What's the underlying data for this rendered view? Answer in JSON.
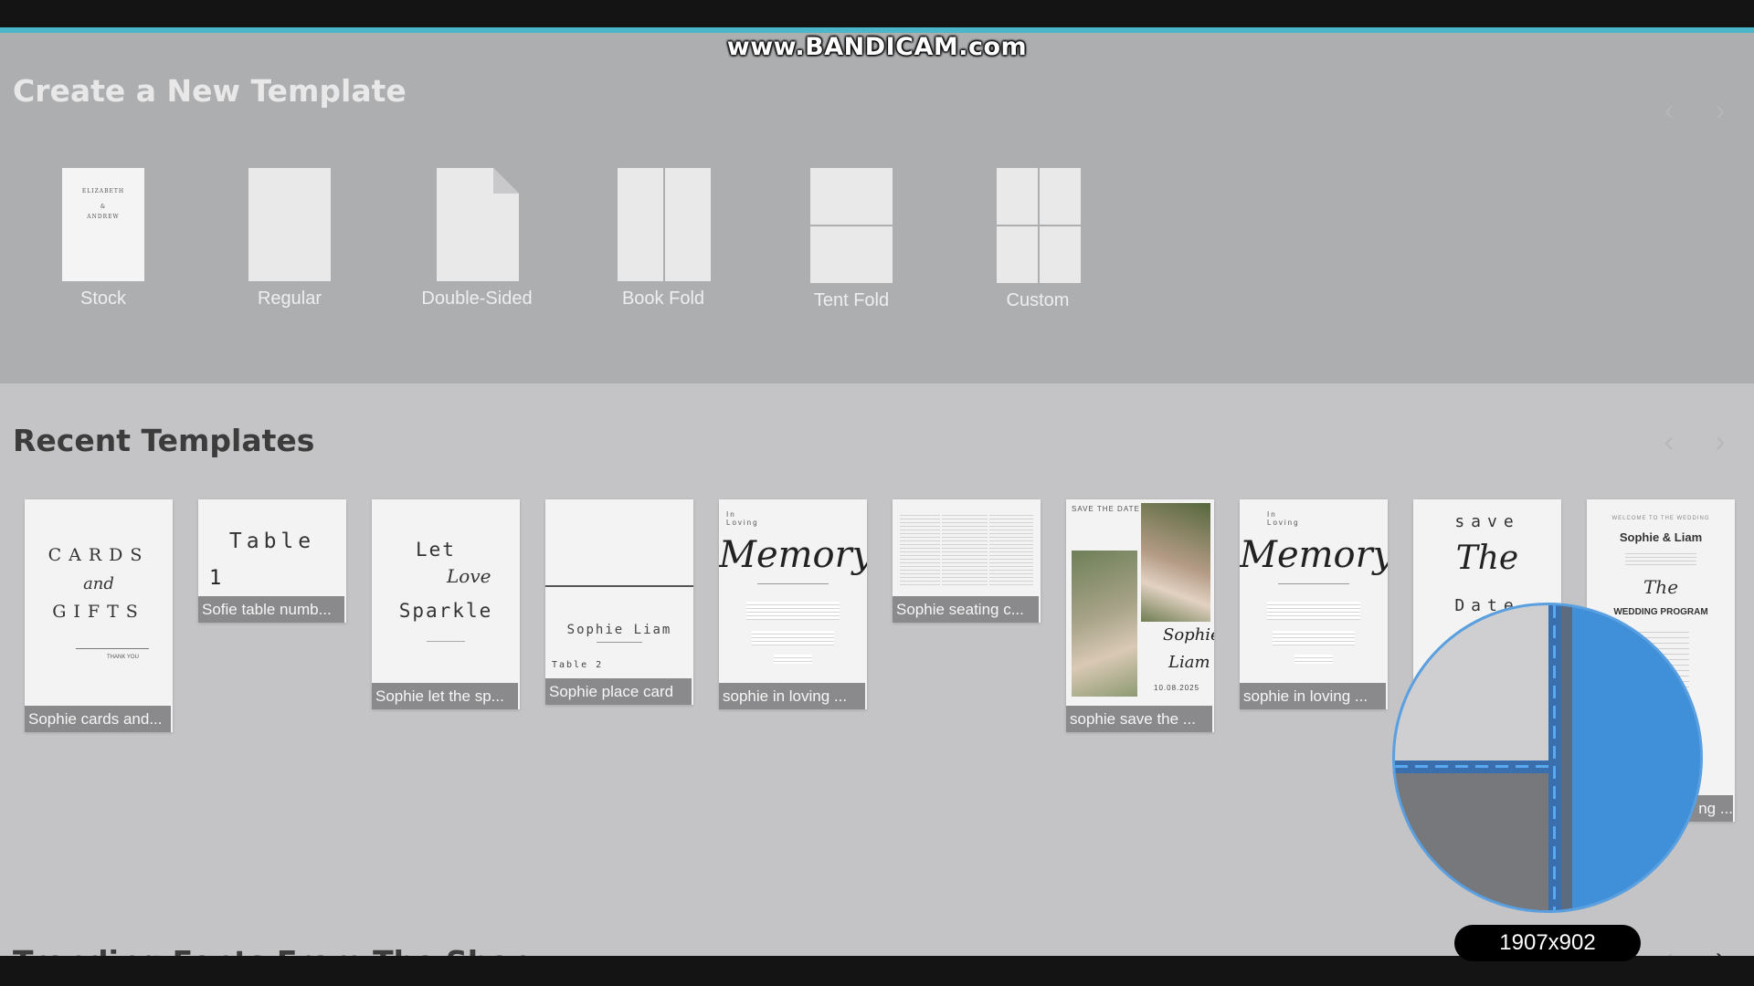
{
  "watermark": "www.BANDICAM.com",
  "create_section": {
    "title": "Create a New Template",
    "types": [
      {
        "label": "Stock",
        "icon": "stock-card-icon"
      },
      {
        "label": "Regular",
        "icon": "regular-page-icon"
      },
      {
        "label": "Double-Sided",
        "icon": "double-sided-page-icon"
      },
      {
        "label": "Book Fold",
        "icon": "book-fold-icon"
      },
      {
        "label": "Tent Fold",
        "icon": "tent-fold-icon"
      },
      {
        "label": "Custom",
        "icon": "custom-grid-icon"
      }
    ],
    "stock_preview": [
      "ELIZABETH",
      "&",
      "ANDREW"
    ]
  },
  "recent_section": {
    "title": "Recent Templates",
    "templates": [
      {
        "label": "Sophie cards and...",
        "preview": {
          "line1": "CARDS",
          "script": "and",
          "line2": "GIFTS",
          "footer": "THANK YOU"
        }
      },
      {
        "label": "Sofie table numb...",
        "preview": {
          "line1": "Table",
          "number": "1"
        }
      },
      {
        "label": "Sophie let the sp...",
        "preview": {
          "line1": "Let",
          "script": "Love",
          "line2": "Sparkle"
        }
      },
      {
        "label": "Sophie place card",
        "preview": {
          "names": "Sophie Liam",
          "table": "Table 2"
        }
      },
      {
        "label": "sophie in loving ...",
        "preview": {
          "small": "In Loving",
          "script": "Memory"
        }
      },
      {
        "label": "Sophie seating c...",
        "preview": {}
      },
      {
        "label": "sophie save the ...",
        "preview": {
          "heading": "SAVE THE DATE",
          "script": "Sophie",
          "script2": "Liam",
          "date": "10.08.2025"
        }
      },
      {
        "label": "sophie in loving ...",
        "preview": {
          "small": "In Loving",
          "script": "Memory"
        }
      },
      {
        "label": "",
        "preview": {
          "line1": "save",
          "script": "The",
          "line2": "Date"
        }
      },
      {
        "label": "ng ...",
        "preview": {
          "small": "WELCOME TO THE WEDDING",
          "names": "Sophie & Liam",
          "script": "The",
          "heading": "WEDDING PROGRAM"
        }
      }
    ]
  },
  "next_section_title": "Trending Fonts From The Shop",
  "magnifier": {
    "dimensions": "1907x902"
  }
}
